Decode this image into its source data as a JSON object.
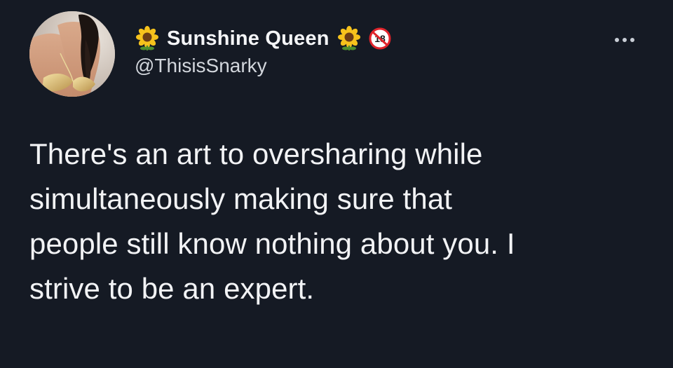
{
  "author": {
    "display_name": "Sunshine Queen",
    "handle": "@ThisisSnarky",
    "name_decorations": [
      "sunflower-icon",
      "sunflower-icon",
      "no-under-18-icon"
    ],
    "badge_text": "18"
  },
  "tweet": {
    "text": "There's an art to oversharing while\nsimultaneously making sure that\npeople still know nothing about you. I\nstrive to be an expert."
  },
  "menu": {
    "icon": "more-options-icon"
  },
  "colors": {
    "background": "#151a24",
    "text_primary": "#f2f3f5",
    "text_secondary": "#d2d6dc",
    "badge_red": "#e0242b"
  }
}
